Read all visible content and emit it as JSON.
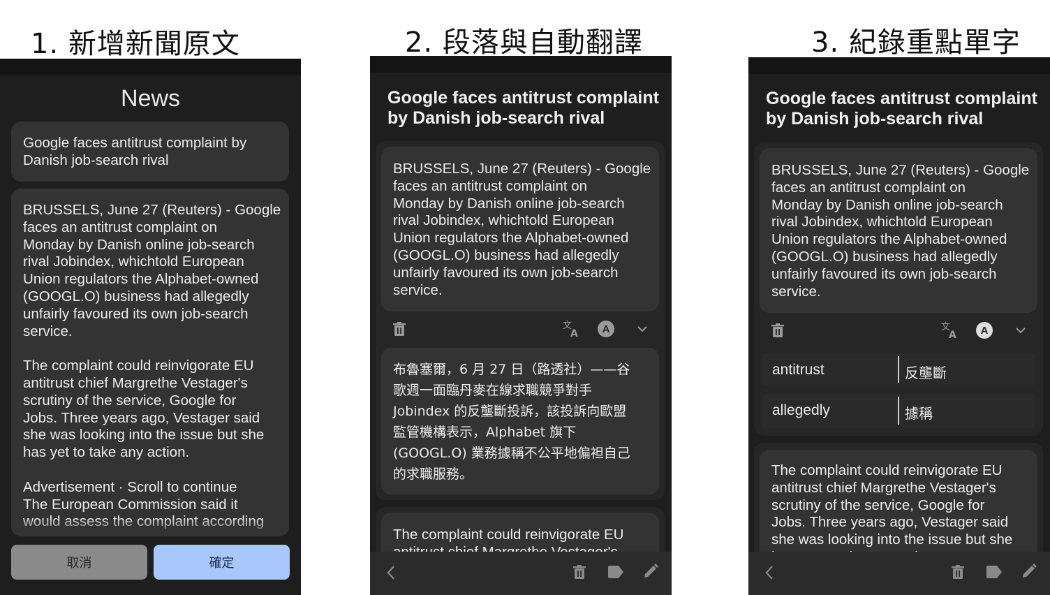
{
  "captions": {
    "step1": "1. 新增新聞原文",
    "step2": "2. 段落與自動翻譯",
    "step3": "3. 紀錄重點單字"
  },
  "screen1": {
    "header": "News",
    "title_field": "Google faces antitrust complaint by\nDanish job-search rival",
    "body_text": "BRUSSELS, June 27 (Reuters) - Google\nfaces an antitrust complaint on\nMonday by Danish online job-search\nrival Jobindex, whichtold European\nUnion regulators the Alphabet-owned\n(GOOGL.O) business had allegedly\nunfairly favoured its own job-search\nservice.\n\nThe complaint could reinvigorate EU\nantitrust chief Margrethe Vestager's\nscrutiny of the service, Google for\nJobs. Three years ago, Vestager said\nshe was looking into the issue but she\nhas yet to take any action.\n\nAdvertisement · Scroll to continue\nThe European Commission said it\nwould assess the complaint according",
    "cancel_label": "取消",
    "confirm_label": "確定"
  },
  "screen2": {
    "title": "Google faces antitrust complaint\nby Danish job-search rival",
    "paragraph1": "BRUSSELS, June 27 (Reuters) - Google\nfaces an antitrust complaint on\nMonday by Danish online job-search\nrival Jobindex, whichtold European\nUnion regulators the Alphabet-owned\n(GOOGL.O) business had allegedly\nunfairly favoured its own job-search\nservice.",
    "translation": "布魯塞爾，6 月 27 日（路透社）——谷\n歌週一面臨丹麥在線求職競爭對手\nJobindex 的反壟斷投訴，該投訴向歐盟\n監管機構表示，Alphabet 旗下\n(GOOGL.O) 業務據稱不公平地偏袒自己\n的求職服務。",
    "paragraph2": "The complaint could reinvigorate EU\nantitrust chief Margrethe Vestager's"
  },
  "screen3": {
    "title": "Google faces antitrust complaint\nby Danish job-search rival",
    "paragraph1": "BRUSSELS, June 27 (Reuters) - Google\nfaces an antitrust complaint on\nMonday by Danish online job-search\nrival Jobindex, whichtold European\nUnion regulators the Alphabet-owned\n(GOOGL.O) business had allegedly\nunfairly favoured its own job-search\nservice.",
    "vocab": [
      {
        "word": "antitrust",
        "meaning": "反壟斷"
      },
      {
        "word": "allegedly",
        "meaning": "據稱"
      }
    ],
    "paragraph2": "The complaint could reinvigorate EU\nantitrust chief Margrethe Vestager's\nscrutiny of the service, Google for\nJobs. Three years ago, Vestager said\nshe was looking into the issue but she\nhas yet to take any action."
  },
  "icons": {
    "delete": "trash-icon",
    "translate": "translate-icon",
    "vocab": "letter-a-circle-icon",
    "expand": "chevron-down-icon",
    "back": "back-arrow-icon",
    "tag": "tag-icon",
    "edit": "pencil-icon"
  },
  "colors": {
    "background": "#1e1e1e",
    "card": "#333333",
    "confirm_button": "#a8c7fa",
    "cancel_button": "#8a8a8a"
  }
}
